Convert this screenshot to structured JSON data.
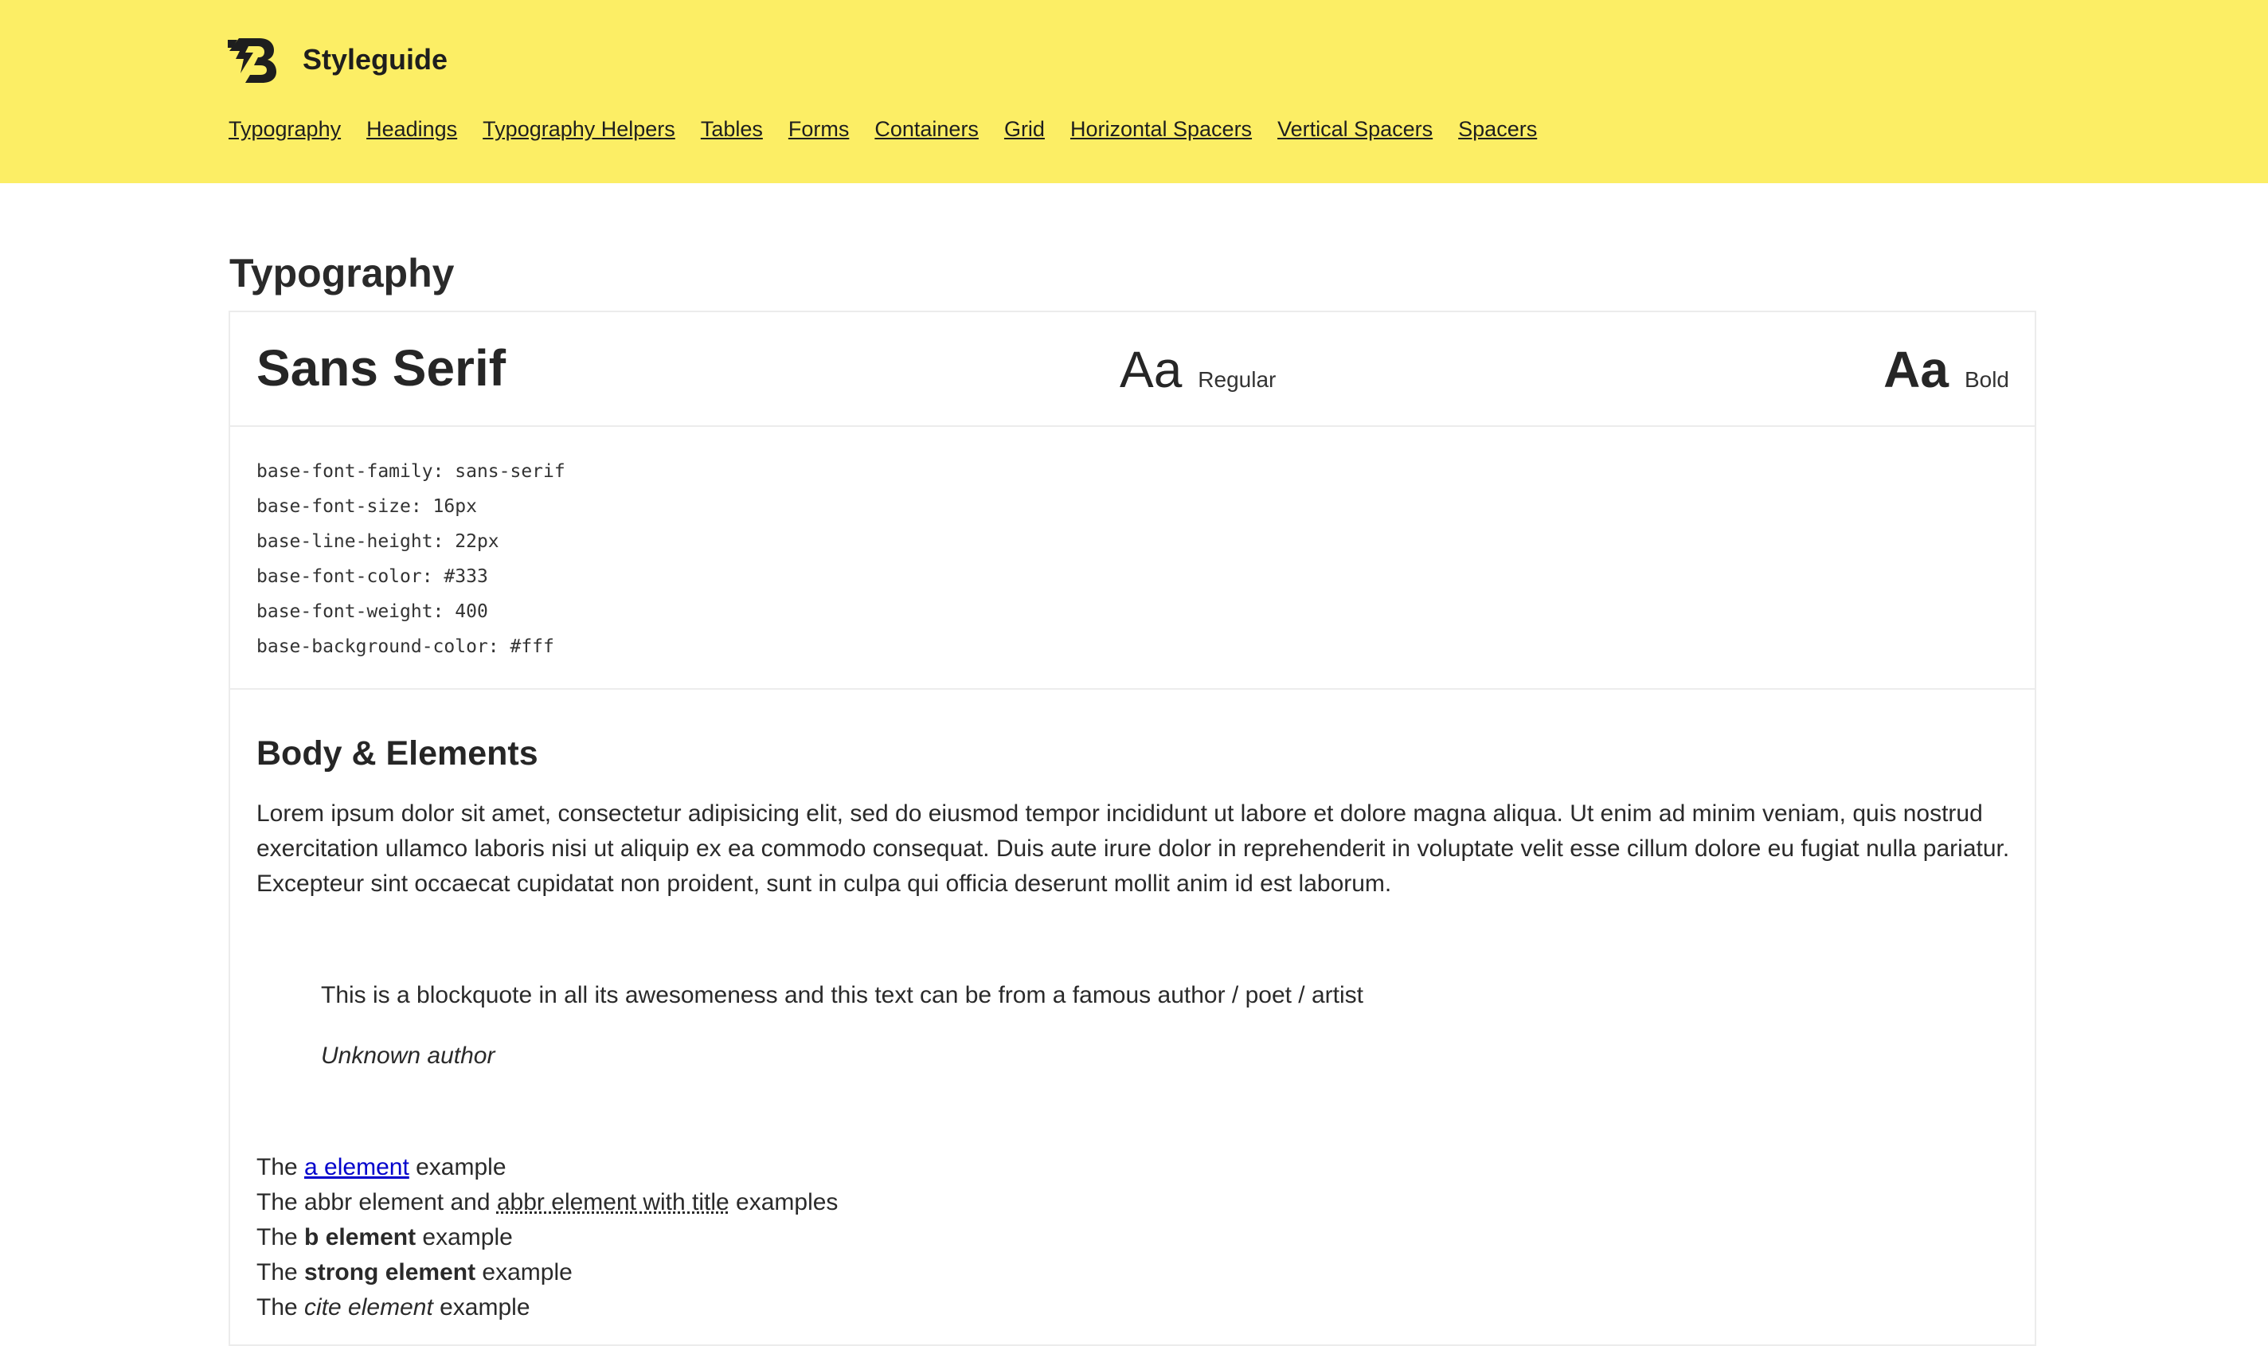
{
  "header": {
    "brand_title": "Styleguide",
    "logo_icon": "b-lightning-logo-icon",
    "background_color": "#fcee65",
    "nav": [
      {
        "label": "Typography"
      },
      {
        "label": "Headings"
      },
      {
        "label": "Typography Helpers"
      },
      {
        "label": "Tables"
      },
      {
        "label": "Forms"
      },
      {
        "label": "Containers"
      },
      {
        "label": "Grid"
      },
      {
        "label": "Horizontal Spacers"
      },
      {
        "label": "Vertical Spacers"
      },
      {
        "label": "Spacers"
      }
    ]
  },
  "main": {
    "page_title": "Typography",
    "font_card": {
      "font_name": "Sans Serif",
      "regular_sample": "Aa",
      "regular_label": "Regular",
      "bold_sample": "Aa",
      "bold_label": "Bold"
    },
    "code_lines": [
      "base-font-family: sans-serif",
      "base-font-size: 16px",
      "base-line-height: 22px",
      "base-font-color: #333",
      "base-font-weight: 400",
      "base-background-color: #fff"
    ],
    "body_section": {
      "title": "Body & Elements",
      "lorem": "Lorem ipsum dolor sit amet, consectetur adipisicing elit, sed do eiusmod tempor incididunt ut labore et dolore magna aliqua. Ut enim ad minim veniam, quis nostrud exercitation ullamco laboris nisi ut aliquip ex ea commodo consequat. Duis aute irure dolor in reprehenderit in voluptate velit esse cillum dolore eu fugiat nulla pariatur. Excepteur sint occaecat cupidatat non proident, sunt in culpa qui officia deserunt mollit anim id est laborum.",
      "blockquote_text": "This is a blockquote in all its awesomeness and this text can be from a famous author / poet / artist",
      "blockquote_author": "Unknown author",
      "examples": {
        "a": {
          "prefix": "The ",
          "element": "a element",
          "suffix": " example"
        },
        "abbr": {
          "prefix": "The abbr element and ",
          "element": "abbr element with title",
          "suffix": " examples"
        },
        "b": {
          "prefix": "The ",
          "element": "b element",
          "suffix": " example"
        },
        "strong": {
          "prefix": "The ",
          "element": "strong element",
          "suffix": " example"
        },
        "cite": {
          "prefix": "The ",
          "element": "cite element",
          "suffix": " example"
        }
      }
    }
  }
}
